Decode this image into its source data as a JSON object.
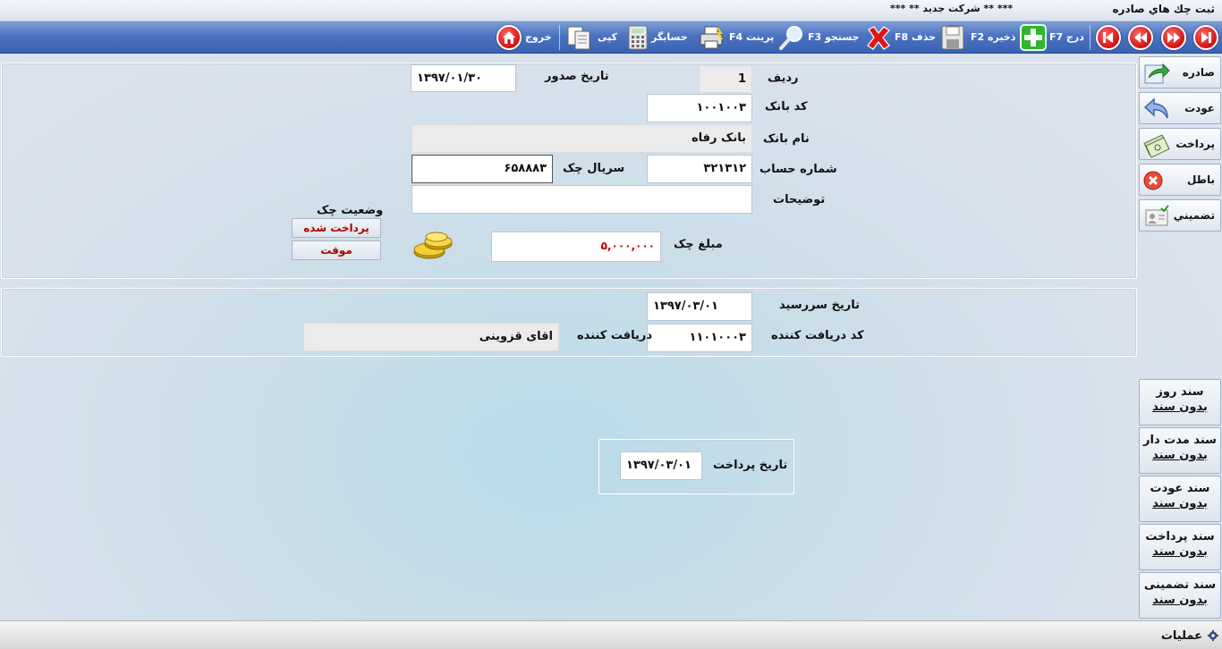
{
  "window": {
    "title": "ثبت چك هاي صادره",
    "company": "***    ** شرکت جديد **    ***"
  },
  "toolbar": {
    "insert_label": "درج F7",
    "save_label": "ذخيره F2",
    "delete_label": "حذف F8",
    "search_label": "جستجو F3",
    "print_label": "پرينت F4",
    "calculator_label": "حسابگر",
    "copy_label": "کپی",
    "exit_label": "خروج"
  },
  "form": {
    "row_label": "رديف",
    "row_value": "1",
    "issue_date_label": "تاريخ صدور",
    "issue_date_value": "۱۳۹۷/۰۱/۳۰",
    "bank_code_label": "کد بانک",
    "bank_code_value": "۱۰۰۱۰۰۳",
    "bank_name_label": "نام بانک",
    "bank_name_value": "بانک رفاه",
    "account_number_label": "شماره حساب",
    "account_number_value": "۳۲۱۳۱۲",
    "check_serial_label": "سريال چک",
    "check_serial_value": "۶۵۸۸۸۳",
    "description_label": "توضيحات",
    "description_value": "",
    "check_status_label": "وضعيت چک",
    "status_paid": "پرداخت شده",
    "status_temporary": "موقت",
    "check_amount_label": "مبلغ چک",
    "check_amount_value": "۵,۰۰۰,۰۰۰"
  },
  "due": {
    "due_date_label": "تاريخ سررسيد",
    "due_date_value": "۱۳۹۷/۰۳/۰۱",
    "receiver_code_label": "کد دريافت کننده",
    "receiver_code_value": "۱۱۰۱۰۰۰۳",
    "receiver_label": "دريافت کننده",
    "receiver_value": "اقای قزوينی"
  },
  "payment": {
    "payment_date_label": "تاريخ پرداخت",
    "payment_date_value": "۱۳۹۷/۰۳/۰۱"
  },
  "side_buttons": {
    "issued": "صادره",
    "returned": "عودت",
    "payment": "پرداخت",
    "void": "باطل",
    "guarantee": "تضميني"
  },
  "documents": [
    {
      "title": "سند روز",
      "status": "بدون سند"
    },
    {
      "title": "سند مدت دار",
      "status": "بدون سند"
    },
    {
      "title": "سند عودت",
      "status": "بدون سند"
    },
    {
      "title": "سند پرداخت",
      "status": "بدون سند"
    },
    {
      "title": "سند تضمينی",
      "status": "بدون سند"
    }
  ],
  "bottom": {
    "operations_label": "عمليات"
  },
  "colors": {
    "toolbar": "#4b73c2",
    "nav_button": "#d41010",
    "amount_text": "#c00000",
    "status_text": "#b00000"
  }
}
